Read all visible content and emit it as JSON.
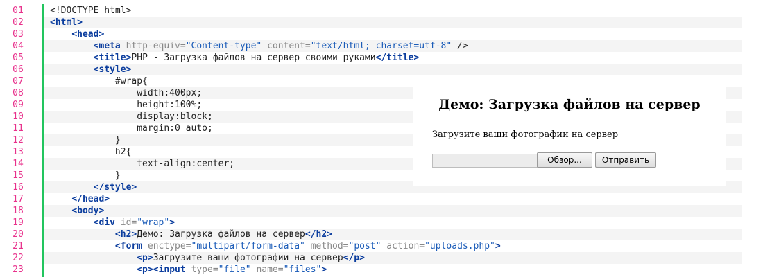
{
  "editor": {
    "lines": [
      {
        "n": "01",
        "tokens": [
          {
            "t": "txt",
            "v": "<!DOCTYPE html>"
          }
        ]
      },
      {
        "n": "02",
        "tokens": [
          {
            "t": "tag",
            "v": "<html>"
          }
        ]
      },
      {
        "n": "03",
        "tokens": [
          {
            "t": "txt",
            "v": "    "
          },
          {
            "t": "tag",
            "v": "<head>"
          }
        ]
      },
      {
        "n": "04",
        "tokens": [
          {
            "t": "txt",
            "v": "        "
          },
          {
            "t": "tag",
            "v": "<meta"
          },
          {
            "t": "attr",
            "v": " http-equiv="
          },
          {
            "t": "str",
            "v": "\"Content-type\""
          },
          {
            "t": "attr",
            "v": " content="
          },
          {
            "t": "str",
            "v": "\"text/html; charset=utf-8\""
          },
          {
            "t": "txt",
            "v": " />"
          }
        ]
      },
      {
        "n": "05",
        "tokens": [
          {
            "t": "txt",
            "v": "        "
          },
          {
            "t": "tag",
            "v": "<title>"
          },
          {
            "t": "txt",
            "v": "PHP - Загрузка файлов на сервер своими руками"
          },
          {
            "t": "tag",
            "v": "</title>"
          }
        ]
      },
      {
        "n": "06",
        "tokens": [
          {
            "t": "txt",
            "v": "        "
          },
          {
            "t": "tag",
            "v": "<style>"
          }
        ]
      },
      {
        "n": "07",
        "tokens": [
          {
            "t": "txt",
            "v": "            #wrap{"
          }
        ]
      },
      {
        "n": "08",
        "tokens": [
          {
            "t": "txt",
            "v": "                width:400px;"
          }
        ]
      },
      {
        "n": "09",
        "tokens": [
          {
            "t": "txt",
            "v": "                height:100%;"
          }
        ]
      },
      {
        "n": "10",
        "tokens": [
          {
            "t": "txt",
            "v": "                display:block;"
          }
        ]
      },
      {
        "n": "11",
        "tokens": [
          {
            "t": "txt",
            "v": "                margin:0 auto;"
          }
        ]
      },
      {
        "n": "12",
        "tokens": [
          {
            "t": "txt",
            "v": "            }"
          }
        ]
      },
      {
        "n": "13",
        "tokens": [
          {
            "t": "txt",
            "v": "            h2{"
          }
        ]
      },
      {
        "n": "14",
        "tokens": [
          {
            "t": "txt",
            "v": "                text-align:center;"
          }
        ]
      },
      {
        "n": "15",
        "tokens": [
          {
            "t": "txt",
            "v": "            }"
          }
        ]
      },
      {
        "n": "16",
        "tokens": [
          {
            "t": "txt",
            "v": "        "
          },
          {
            "t": "tag",
            "v": "</style>"
          }
        ]
      },
      {
        "n": "17",
        "tokens": [
          {
            "t": "txt",
            "v": "    "
          },
          {
            "t": "tag",
            "v": "</head>"
          }
        ]
      },
      {
        "n": "18",
        "tokens": [
          {
            "t": "txt",
            "v": "    "
          },
          {
            "t": "tag",
            "v": "<body>"
          }
        ]
      },
      {
        "n": "19",
        "tokens": [
          {
            "t": "txt",
            "v": "        "
          },
          {
            "t": "tag",
            "v": "<div"
          },
          {
            "t": "attr",
            "v": " id="
          },
          {
            "t": "str",
            "v": "\"wrap\""
          },
          {
            "t": "tag",
            "v": ">"
          }
        ]
      },
      {
        "n": "20",
        "tokens": [
          {
            "t": "txt",
            "v": "            "
          },
          {
            "t": "tag",
            "v": "<h2>"
          },
          {
            "t": "txt",
            "v": "Демо: Загрузка файлов на сервер"
          },
          {
            "t": "tag",
            "v": "</h2>"
          }
        ]
      },
      {
        "n": "21",
        "tokens": [
          {
            "t": "txt",
            "v": "            "
          },
          {
            "t": "tag",
            "v": "<form"
          },
          {
            "t": "attr",
            "v": " enctype="
          },
          {
            "t": "str",
            "v": "\"multipart/form-data\""
          },
          {
            "t": "attr",
            "v": " method="
          },
          {
            "t": "str",
            "v": "\"post\""
          },
          {
            "t": "attr",
            "v": " action="
          },
          {
            "t": "str",
            "v": "\"uploads.php\""
          },
          {
            "t": "tag",
            "v": ">"
          }
        ]
      },
      {
        "n": "22",
        "tokens": [
          {
            "t": "txt",
            "v": "                "
          },
          {
            "t": "tag",
            "v": "<p>"
          },
          {
            "t": "txt",
            "v": "Загрузите ваши фотографии на сервер"
          },
          {
            "t": "tag",
            "v": "</p>"
          }
        ]
      },
      {
        "n": "23",
        "tokens": [
          {
            "t": "txt",
            "v": "                "
          },
          {
            "t": "tag",
            "v": "<p><input"
          },
          {
            "t": "attr",
            "v": " type="
          },
          {
            "t": "str",
            "v": "\"file\""
          },
          {
            "t": "attr",
            "v": " name="
          },
          {
            "t": "str",
            "v": "\"files\""
          },
          {
            "t": "tag",
            "v": ">"
          }
        ]
      }
    ]
  },
  "demo": {
    "heading": "Демо: Загрузка файлов на сервер",
    "prompt": "Загрузите ваши фотографии на сервер",
    "browse_label": "Обзор...",
    "submit_label": "Отправить"
  }
}
